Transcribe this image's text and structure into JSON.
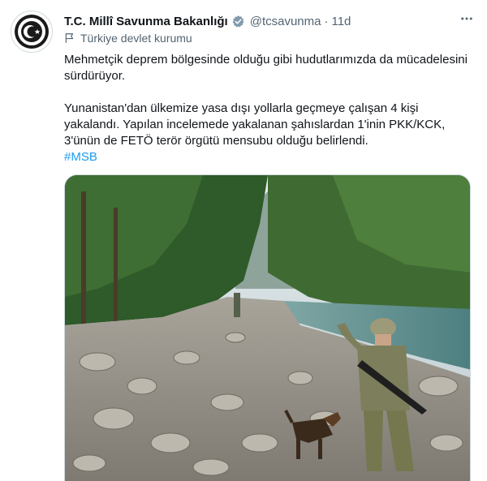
{
  "account": {
    "display_name": "T.C. Millî Savunma Bakanlığı",
    "handle": "@tcsavunma",
    "separator": "·",
    "time": "11d",
    "affiliation_label": "Türkiye devlet kurumu",
    "avatar_icon": "ministry-emblem-icon",
    "verified_icon": "verified-badge-icon",
    "verified_color": "#829aab"
  },
  "tweet": {
    "paragraph1": "Mehmetçik deprem bölgesinde olduğu gibi hudutlarımızda da mücadelesini sürdürüyor.",
    "paragraph2": "Yunanistan'dan ülkemize yasa dışı yollarla geçmeye çalışan 4 kişi yakalandı. Yapılan incelemede yakalanan şahıslardan 1'inin PKK/KCK, 3'ünün de FETÖ terör örgütü mensubu olduğu belirlendi.",
    "hashtag": "#MSB",
    "hashtag_color": "#1d9bf0"
  },
  "media": {
    "icon": "photo-soldier-dog-riverbed"
  },
  "icons": {
    "more": "more-dots-icon",
    "flag": "flag-icon"
  }
}
